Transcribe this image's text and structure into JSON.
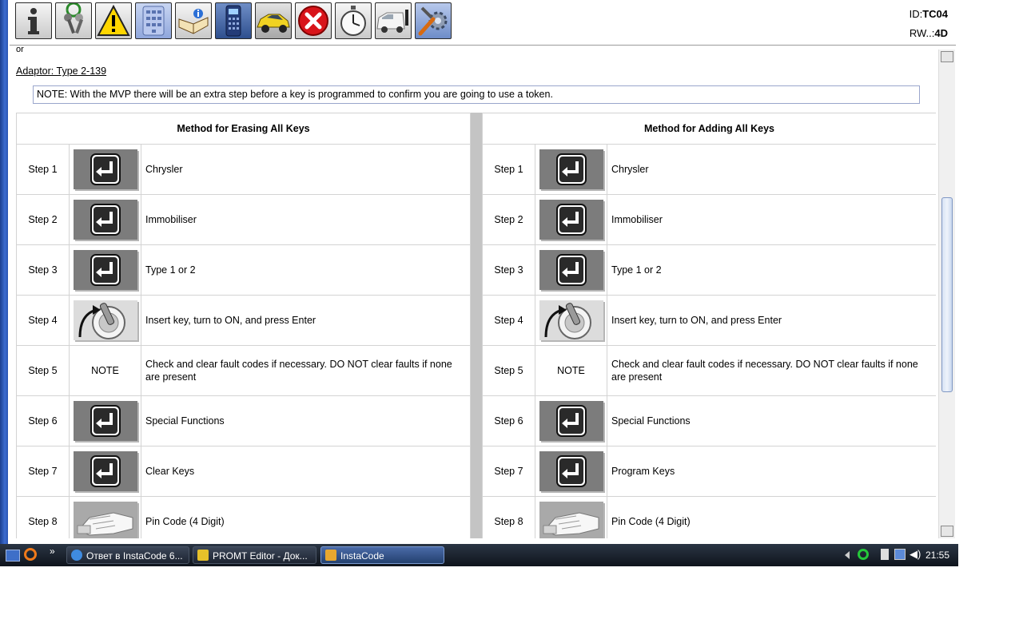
{
  "window": {
    "id_label": "ID:",
    "id_value": "TC04",
    "rw_label": "RW..:",
    "rw_value": "4D"
  },
  "toolbar": {
    "buttons": [
      {
        "name": "info-icon"
      },
      {
        "name": "keys-icon"
      },
      {
        "name": "warning-icon"
      },
      {
        "name": "keypad-icon"
      },
      {
        "name": "book-icon"
      },
      {
        "name": "programmer-device-icon"
      },
      {
        "name": "car-icon"
      },
      {
        "name": "close-icon"
      },
      {
        "name": "stopwatch-icon"
      },
      {
        "name": "van-icon"
      },
      {
        "name": "settings-tools-icon"
      }
    ]
  },
  "content": {
    "cut_text": "or",
    "adaptor_link": "Adaptor: Type 2-139",
    "note": "NOTE: With the MVP there will be an extra step before a key is programmed to confirm you are going to use a token."
  },
  "erase_table": {
    "title": "Method for Erasing All Keys",
    "rows": [
      {
        "step": "Step 1",
        "icon": "enter",
        "text": "Chrysler"
      },
      {
        "step": "Step 2",
        "icon": "enter",
        "text": "Immobiliser"
      },
      {
        "step": "Step 3",
        "icon": "enter",
        "text": "Type 1 or 2"
      },
      {
        "step": "Step 4",
        "icon": "ignition",
        "text": "Insert key, turn to ON, and press Enter"
      },
      {
        "step": "Step 5",
        "icon": "NOTE",
        "text": "Check and clear fault codes if necessary. DO NOT clear faults if none are present"
      },
      {
        "step": "Step 6",
        "icon": "enter",
        "text": "Special Functions"
      },
      {
        "step": "Step 7",
        "icon": "enter",
        "text": "Clear Keys"
      },
      {
        "step": "Step 8",
        "icon": "hand",
        "text": "Pin Code (4 Digit)"
      }
    ]
  },
  "add_table": {
    "title": "Method for Adding All Keys",
    "rows": [
      {
        "step": "Step 1",
        "icon": "enter",
        "text": "Chrysler"
      },
      {
        "step": "Step 2",
        "icon": "enter",
        "text": "Immobiliser"
      },
      {
        "step": "Step 3",
        "icon": "enter",
        "text": "Type 1 or 2"
      },
      {
        "step": "Step 4",
        "icon": "ignition",
        "text": "Insert key, turn to ON, and press Enter"
      },
      {
        "step": "Step 5",
        "icon": "NOTE",
        "text": "Check and clear fault codes if necessary. DO NOT clear faults if none are present"
      },
      {
        "step": "Step 6",
        "icon": "enter",
        "text": "Special Functions"
      },
      {
        "step": "Step 7",
        "icon": "enter",
        "text": "Program Keys"
      },
      {
        "step": "Step 8",
        "icon": "hand",
        "text": "Pin Code (4 Digit)"
      }
    ]
  },
  "taskbar": {
    "items": [
      {
        "label": "Ответ в InstaCode 6...",
        "icon": "ie-icon"
      },
      {
        "label": "PROMT Editor - Док...",
        "icon": "promt-icon"
      },
      {
        "label": "InstaCode",
        "icon": "instacode-icon"
      }
    ],
    "clock": "21:55"
  },
  "colors": {
    "icon_dark": "#7c7c7c",
    "divider": "#c4c4c4",
    "taskbar": "#1a2230",
    "sidebar": "#2a55b3"
  }
}
